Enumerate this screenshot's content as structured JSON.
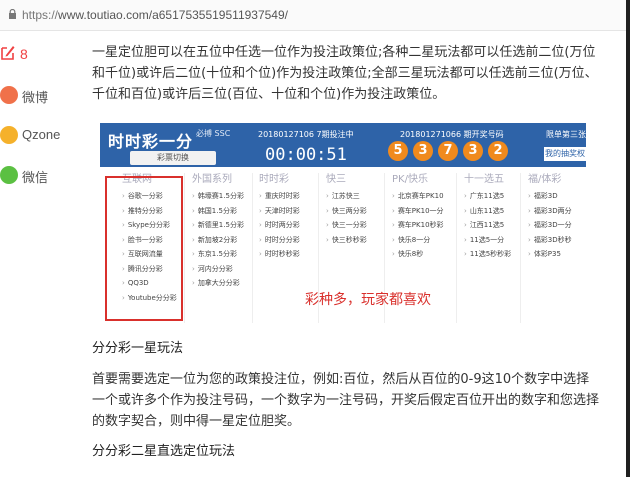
{
  "browser": {
    "url_scheme": "https://",
    "url_rest": "www.toutiao.com/a6517535519511937549/"
  },
  "sidebar": {
    "comment_count": "8",
    "items": [
      {
        "label": "微博",
        "icon": "weibo-icon",
        "color": "#f0714a"
      },
      {
        "label": "Qzone",
        "icon": "qzone-icon",
        "color": "#f5b12b"
      },
      {
        "label": "微信",
        "icon": "wechat-icon",
        "color": "#5bc042"
      }
    ]
  },
  "article": {
    "para1": "一星定位胆可以在五位中任选一位作为投注政策位;各种二星玩法都可以任选前二位(万位和千位)或许后二位(十位和个位)作为投注政策位;全部三星玩法都可以任选前三位(万位、千位和百位)或许后三位(百位、十位和个位)作为投注政策位。",
    "heading1": "分分彩一星玩法",
    "para2": "首要需要选定一位为您的政策投注位，例如:百位，然后从百位的0-9这10个数字中选择一个或许多个作为投注号码，一个数字为一注号码，开奖后假定百位开出的数字和您选择的数字契合，则中得一星定位胆奖。",
    "heading2": "分分彩二星直选定位玩法"
  },
  "promo": {
    "logo": "时时彩一分",
    "logo_sub": "必搏 SSC",
    "select_label": "彩票切换",
    "issue_current": "20180127106 7期投注中",
    "timer": "00:00:51",
    "issue_prev": "201801271066 期开奖号码",
    "balls": [
      "5",
      "3",
      "7",
      "3",
      "2"
    ],
    "right_label": "限单第三张",
    "right_button": "我的抽奖权",
    "slogan": "彩种多，玩家都喜欢",
    "accent_color": "#2e63a8",
    "highlight_color": "#d9302c",
    "columns": [
      {
        "title": "互联网",
        "items": [
          "谷歌一分彩",
          "推特分分彩",
          "Skype分分彩",
          "脸书一分彩",
          "互联网流量",
          "腾讯分分彩",
          "QQ3D",
          "Youtube分分彩"
        ]
      },
      {
        "title": "外国系列",
        "items": [
          "韩壕赛1.5分彩",
          "韩国1.5分彩",
          "新德里1.5分彩",
          "新加坡2分彩",
          "东京1.5分彩",
          "河内分分彩",
          "加拿大分分彩"
        ]
      },
      {
        "title": "时时彩",
        "items": [
          "重庆时时彩",
          "天津时时彩",
          "时时两分彩",
          "时时分分彩",
          "时时秒秒彩"
        ]
      },
      {
        "title": "快三",
        "items": [
          "江苏快三",
          "快三两分彩",
          "快三一分彩",
          "快三秒秒彩"
        ]
      },
      {
        "title": "PK/快乐",
        "items": [
          "北京赛车PK10",
          "赛车PK10一分",
          "赛车PK10秒彩",
          "快乐8一分",
          "快乐8秒"
        ]
      },
      {
        "title": "十一选五",
        "items": [
          "广东11选5",
          "山东11选5",
          "江西11选5",
          "11选5一分",
          "11选5秒秒彩"
        ]
      },
      {
        "title": "福/体彩",
        "items": [
          "福彩3D",
          "福彩3D两分",
          "福彩3D一分",
          "福彩3D秒秒",
          "体彩P35"
        ]
      }
    ]
  }
}
